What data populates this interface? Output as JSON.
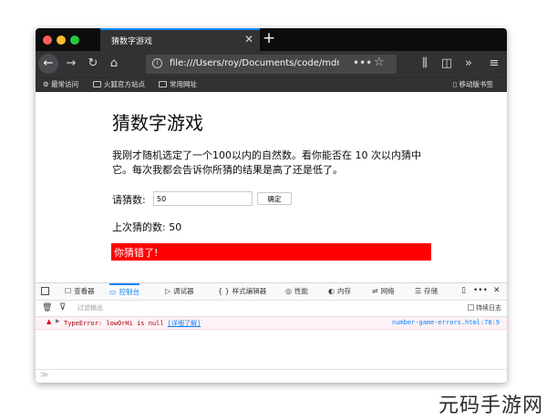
{
  "browser": {
    "tab_title": "猜数字游戏",
    "tab_close": "✕",
    "new_tab": "+",
    "url": "file:///Users/roy/Documents/code/mdn",
    "bookmarks": [
      "最常访问",
      "火狐官方站点",
      "常用网址"
    ],
    "mobile_bookmarks": "移动版书签"
  },
  "page": {
    "heading": "猜数字游戏",
    "intro": "我刚才随机选定了一个100以内的自然数。看你能否在 10 次以内猜中它。每次我都会告诉你所猜的结果是高了还是低了。",
    "guess_label": "请猜数:",
    "guess_value": "50",
    "submit_label": "确定",
    "last_guess": "上次猜的数: 50",
    "result": "你猜错了!",
    "result_color": "#ff0000"
  },
  "devtools": {
    "tabs": [
      {
        "icon": "☐",
        "label": "查看器"
      },
      {
        "icon": "▭",
        "label": "控制台"
      },
      {
        "icon": "▷",
        "label": "调试器"
      },
      {
        "icon": "{ }",
        "label": "样式编辑器"
      },
      {
        "icon": "◎",
        "label": "性能"
      },
      {
        "icon": "◐",
        "label": "内存"
      },
      {
        "icon": "⇌",
        "label": "网络"
      },
      {
        "icon": "☰",
        "label": "存储"
      }
    ],
    "active_tab": "控制台",
    "filter_placeholder": "过滤输出",
    "persist_logs": "持续日志",
    "error": {
      "message": "TypeError: lowOrHi is null",
      "learn_more": "[详细了解]",
      "source": "number-game-errors.html:78:9"
    }
  },
  "watermark": "元码手游网"
}
